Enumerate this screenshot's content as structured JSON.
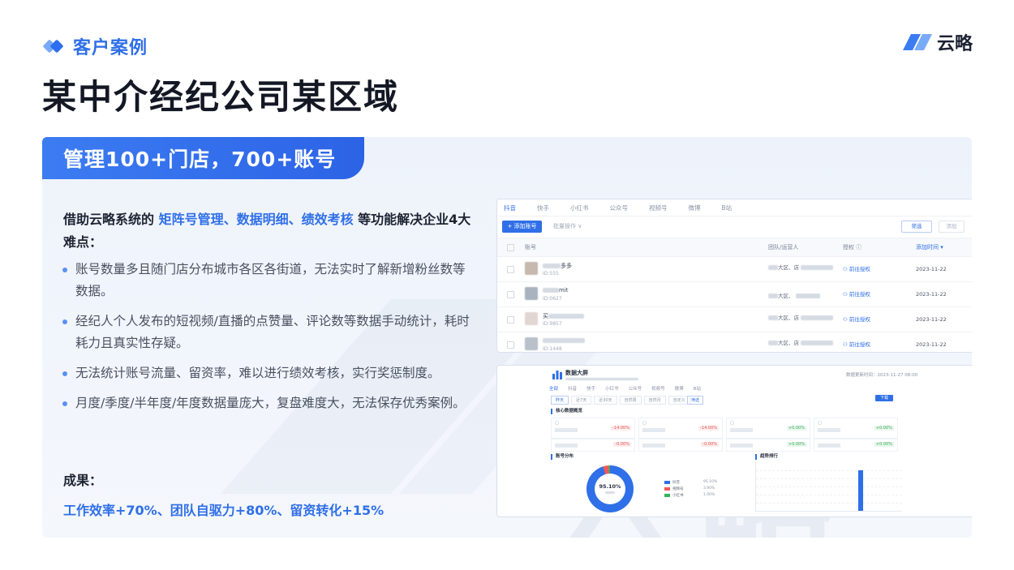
{
  "header": {
    "tag": "客户案例",
    "title": "某中介经纪公司某区域",
    "brand": "云略"
  },
  "card": {
    "ribbon": "管理100+门店，700+账号",
    "watermark": "云略",
    "intro": {
      "before": "借助云略系统的 ",
      "highlight": "矩阵号管理、数据明细、绩效考核",
      "after": " 等功能解决企业4大难点："
    },
    "points": [
      "账号数量多且随门店分布城市各区各街道，无法实时了解新增粉丝数等数据。",
      "经纪人个人发布的短视频/直播的点赞量、评论数等数据手动统计，耗时耗力且真实性存疑。",
      "无法统计账号流量、留资率，难以进行绩效考核，实行奖惩制度。",
      "月度/季度/半年度/年度数据量庞大，复盘难度大，无法保存优秀案例。"
    ],
    "result_label": "成果：",
    "result_text": "工作效率+70%、团队自驱力+80%、留资转化+15%"
  },
  "accounts": {
    "tabs": [
      "抖音",
      "快手",
      "小红书",
      "公众号",
      "视频号",
      "微博",
      "B站"
    ],
    "add_button": "+ 添加账号",
    "batch": "批量操作 ∨",
    "filter_button": "筛选",
    "more_button": "添加",
    "columns": {
      "account": "账号",
      "team": "团队/运营人",
      "auth": "授权 ⓘ",
      "added": "添加时间 ▾"
    },
    "rows": [
      {
        "name": "多多",
        "id": "ID:555",
        "team": "大区、店",
        "auth": "前往授权",
        "date": "2023-11-22"
      },
      {
        "name": "mit",
        "id": "ID:0627",
        "team": "大区、",
        "auth": "前往授权",
        "date": "2023-11-22"
      },
      {
        "name": "买",
        "id": "ID:9857",
        "team": "大区、店",
        "auth": "前往授权",
        "date": "2023-11-22"
      },
      {
        "name": "",
        "id": "ID:1448",
        "team": "大区、店",
        "auth": "前往授权",
        "date": "2023-11-22"
      }
    ]
  },
  "dashboard": {
    "title": "数据大屏",
    "time": "数据更新时间：2023-11-27 08:00",
    "tabs": [
      "全部",
      "抖音",
      "快手",
      "小红书",
      "公众号",
      "视频号",
      "微博",
      "B站"
    ],
    "periods": [
      "昨天",
      "近7天",
      "近30天",
      "自然周",
      "自然月",
      "自定义"
    ],
    "query_button": "筛选",
    "export_button": "下载",
    "section_core": "核心数据概览",
    "section_share": "账号分布",
    "section_trend": "趋势排行",
    "metric_trends": [
      "-14.00%",
      "-14.00%",
      "+0.00%",
      "+0.00%",
      "-0.00%",
      "-0.00%",
      "+0.00%",
      "+0.00%"
    ],
    "donut_pct": "95.10%",
    "legend": [
      {
        "label": "抖音",
        "value": "95.10%",
        "color": "#2f6fe8"
      },
      {
        "label": "视频号",
        "value": "3.90%",
        "color": "#ee5a5a"
      },
      {
        "label": "小红书",
        "value": "1.00%",
        "color": "#35b45a"
      }
    ],
    "trend_bar_level": 0.84
  }
}
